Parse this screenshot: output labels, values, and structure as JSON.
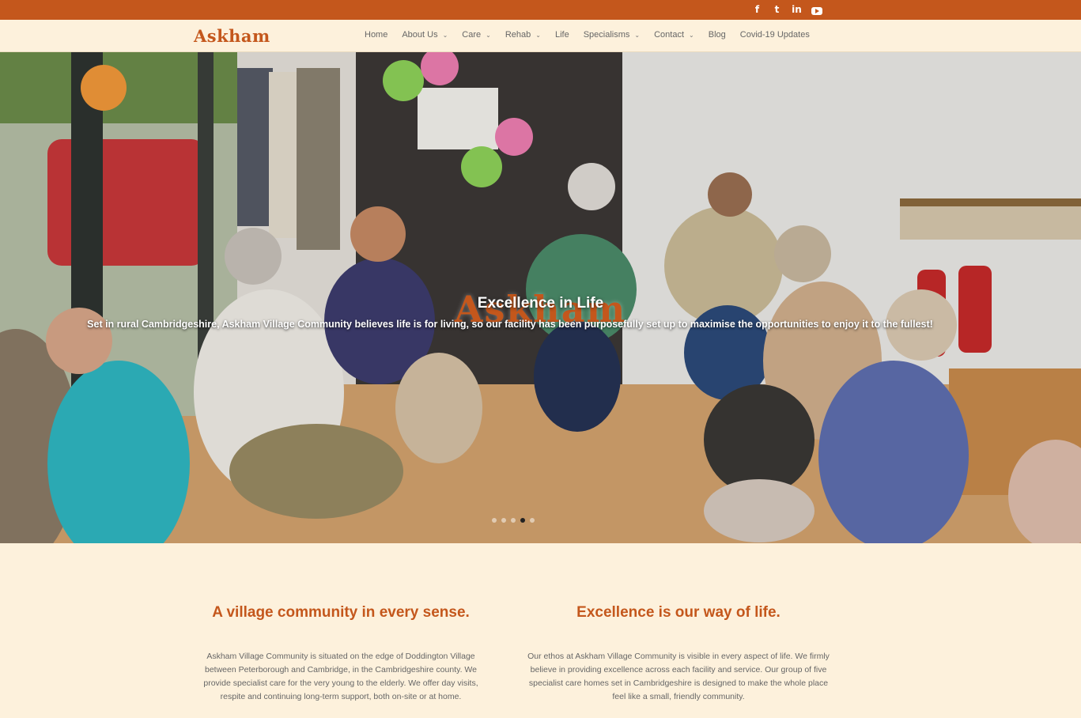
{
  "colors": {
    "brand": "#c4571c",
    "background": "#fdf1dc"
  },
  "social": [
    "facebook-icon",
    "twitter-icon",
    "linkedin-icon",
    "youtube-icon"
  ],
  "header": {
    "logo": "Askham",
    "nav": [
      {
        "label": "Home",
        "dropdown": false
      },
      {
        "label": "About Us",
        "dropdown": true
      },
      {
        "label": "Care",
        "dropdown": true
      },
      {
        "label": "Rehab",
        "dropdown": true
      },
      {
        "label": "Life",
        "dropdown": false
      },
      {
        "label": "Specialisms",
        "dropdown": true
      },
      {
        "label": "Contact",
        "dropdown": true
      },
      {
        "label": "Blog",
        "dropdown": false
      },
      {
        "label": "Covid-19 Updates",
        "dropdown": false
      }
    ]
  },
  "hero": {
    "logo": "Askham",
    "title": "Excellence in Life",
    "subtitle": "Set in rural Cambridgeshire, Askham Village Community believes life is for living, so our facility has been purposefully set up to maximise the opportunities to enjoy it to the fullest!",
    "slides": 4,
    "active_slide": 3
  },
  "main": {
    "col1": {
      "heading": "A village community in every sense.",
      "body": "Askham Village Community is situated on the edge of Doddington Village between Peterborough and Cambridge, in the Cambridgeshire county. We provide specialist care for the very young to the elderly. We offer day visits, respite and continuing long-term support, both on-site or at home."
    },
    "col2": {
      "heading": "Excellence is our way of life.",
      "body": "Our ethos at Askham Village Community is visible in every aspect of life. We firmly believe in providing excellence across each facility and service. Our group of five specialist care homes set in Cambridgeshire is designed  to make the whole place feel like a small, friendly community."
    }
  }
}
